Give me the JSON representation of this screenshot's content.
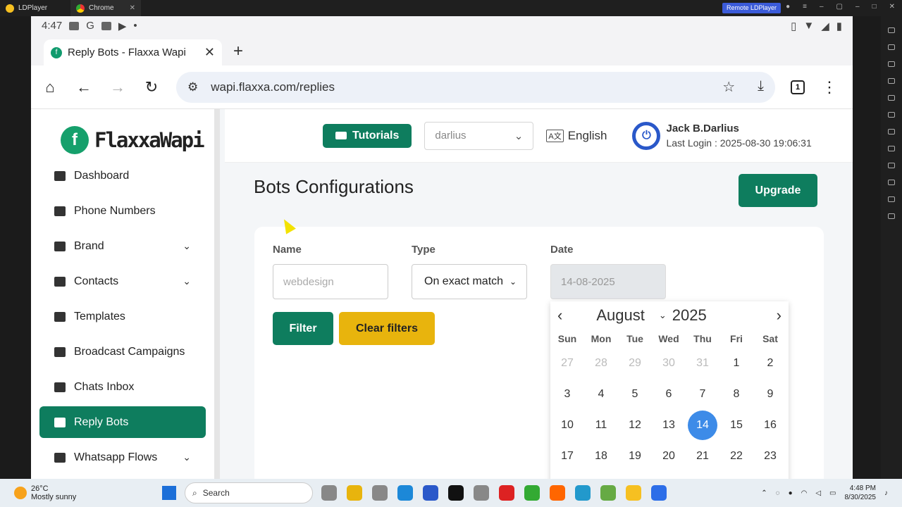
{
  "ld": {
    "tab1": "LDPlayer",
    "tab2": "Chrome",
    "remote": "Remote LDPlayer"
  },
  "status": {
    "time": "4:47"
  },
  "browser": {
    "tab_title": "Reply Bots - Flaxxa Wapi",
    "url": "wapi.flaxxa.com/replies",
    "tab_count": "1"
  },
  "brand": {
    "logo_text": "FlaxxaWapi",
    "logo_letter": "f"
  },
  "sidebar": {
    "items": [
      {
        "label": "Dashboard",
        "icon": "dashboard-icon"
      },
      {
        "label": "Phone Numbers",
        "icon": "phone-icon"
      },
      {
        "label": "Brand",
        "icon": "brand-icon"
      },
      {
        "label": "Contacts",
        "icon": "contacts-icon"
      },
      {
        "label": "Templates",
        "icon": "templates-icon"
      },
      {
        "label": "Broadcast Campaigns",
        "icon": "broadcast-icon"
      },
      {
        "label": "Chats Inbox",
        "icon": "chats-icon"
      },
      {
        "label": "Reply Bots",
        "icon": "reply-icon"
      },
      {
        "label": "Whatsapp Flows",
        "icon": "whatsapp-icon"
      }
    ]
  },
  "topbar": {
    "tutorials": "Tutorials",
    "account_select": "darlius",
    "language": "English",
    "user_name": "Jack B.Darlius",
    "last_login": "Last Login : 2025-08-30 19:06:31"
  },
  "page": {
    "title": "Bots Configurations",
    "upgrade": "Upgrade"
  },
  "filters": {
    "name_label": "Name",
    "name_placeholder": "webdesign",
    "type_label": "Type",
    "type_value": "On exact match",
    "date_label": "Date",
    "date_value": "14-08-2025",
    "filter_button": "Filter",
    "clear_button": "Clear filters"
  },
  "calendar": {
    "month": "August",
    "year": "2025",
    "dow": [
      "Sun",
      "Mon",
      "Tue",
      "Wed",
      "Thu",
      "Fri",
      "Sat"
    ],
    "days": [
      {
        "d": "27",
        "m": true
      },
      {
        "d": "28",
        "m": true
      },
      {
        "d": "29",
        "m": true
      },
      {
        "d": "30",
        "m": true
      },
      {
        "d": "31",
        "m": true
      },
      {
        "d": "1"
      },
      {
        "d": "2"
      },
      {
        "d": "3"
      },
      {
        "d": "4"
      },
      {
        "d": "5"
      },
      {
        "d": "6"
      },
      {
        "d": "7"
      },
      {
        "d": "8"
      },
      {
        "d": "9"
      },
      {
        "d": "10"
      },
      {
        "d": "11"
      },
      {
        "d": "12"
      },
      {
        "d": "13"
      },
      {
        "d": "14",
        "s": true
      },
      {
        "d": "15"
      },
      {
        "d": "16"
      },
      {
        "d": "17"
      },
      {
        "d": "18"
      },
      {
        "d": "19"
      },
      {
        "d": "20"
      },
      {
        "d": "21"
      },
      {
        "d": "22"
      },
      {
        "d": "23"
      }
    ]
  },
  "taskbar": {
    "temp": "26°C",
    "weather": "Mostly sunny",
    "search": "Search",
    "time": "4:48 PM",
    "date": "8/30/2025"
  },
  "colors": {
    "primary": "#0e7d5e",
    "accent": "#e8b40d",
    "selected_day": "#3d8be8"
  }
}
